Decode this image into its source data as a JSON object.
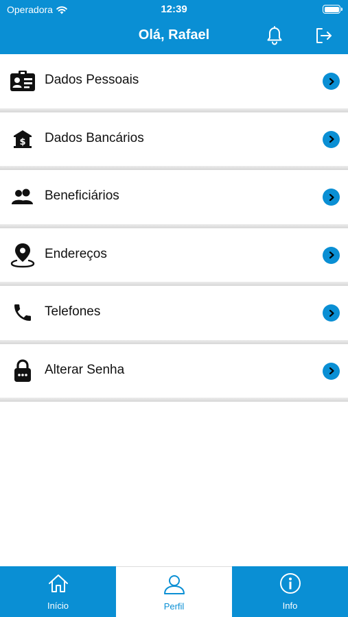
{
  "status_bar": {
    "carrier": "Operadora",
    "time": "12:39"
  },
  "header": {
    "greeting": "Olá, Rafael",
    "notifications_icon": "bell-icon",
    "logout_icon": "logout-icon"
  },
  "menu": {
    "items": [
      {
        "label": "Dados Pessoais",
        "icon": "id-card-icon"
      },
      {
        "label": "Dados Bancários",
        "icon": "bank-icon"
      },
      {
        "label": "Beneficiários",
        "icon": "people-icon"
      },
      {
        "label": "Endereços",
        "icon": "location-pin-icon"
      },
      {
        "label": "Telefones",
        "icon": "phone-icon"
      },
      {
        "label": "Alterar Senha",
        "icon": "lock-icon"
      }
    ]
  },
  "tabbar": {
    "tabs": [
      {
        "label": "Início",
        "icon": "home-icon",
        "active": false
      },
      {
        "label": "Perfil",
        "icon": "user-icon",
        "active": true
      },
      {
        "label": "Info",
        "icon": "info-icon",
        "active": false
      }
    ]
  },
  "colors": {
    "primary": "#0a8fd4",
    "background": "#ffffff",
    "divider": "#d6d6d6",
    "text": "#111111"
  }
}
